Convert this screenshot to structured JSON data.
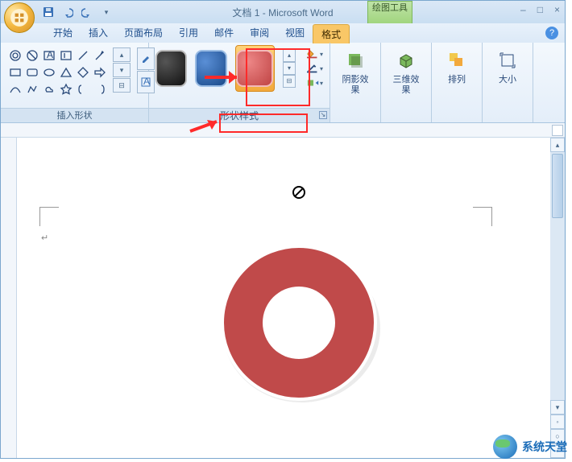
{
  "title": "文档 1 - Microsoft Word",
  "contextual_tab": "绘图工具",
  "tabs": [
    "开始",
    "插入",
    "页面布局",
    "引用",
    "邮件",
    "审阅",
    "视图",
    "格式"
  ],
  "active_tab_index": 7,
  "groups": {
    "insert_shapes": {
      "label": "插入形状"
    },
    "shape_styles": {
      "label": "形状样式"
    },
    "shadow": {
      "label": "阴影效果"
    },
    "threed": {
      "label": "三维效果"
    },
    "arrange": {
      "label": "排列"
    },
    "size": {
      "label": "大小"
    }
  },
  "qat": {
    "save": "保存",
    "undo": "撤销",
    "redo": "重做"
  },
  "win": {
    "min": "–",
    "max": "□",
    "close": "×"
  },
  "help": "?",
  "watermark": "系统天堂",
  "shape_style_gallery": {
    "items": [
      {
        "name": "black-rounded",
        "selected": false
      },
      {
        "name": "blue-rounded",
        "selected": false
      },
      {
        "name": "red-rounded",
        "selected": true
      }
    ]
  },
  "style_options": {
    "fill": "形状填充",
    "outline": "形状轮廓",
    "change": "更改形状"
  },
  "canvas_shape": {
    "type": "donut",
    "fill": "#c04a4a",
    "stroke": "#ffffff"
  }
}
